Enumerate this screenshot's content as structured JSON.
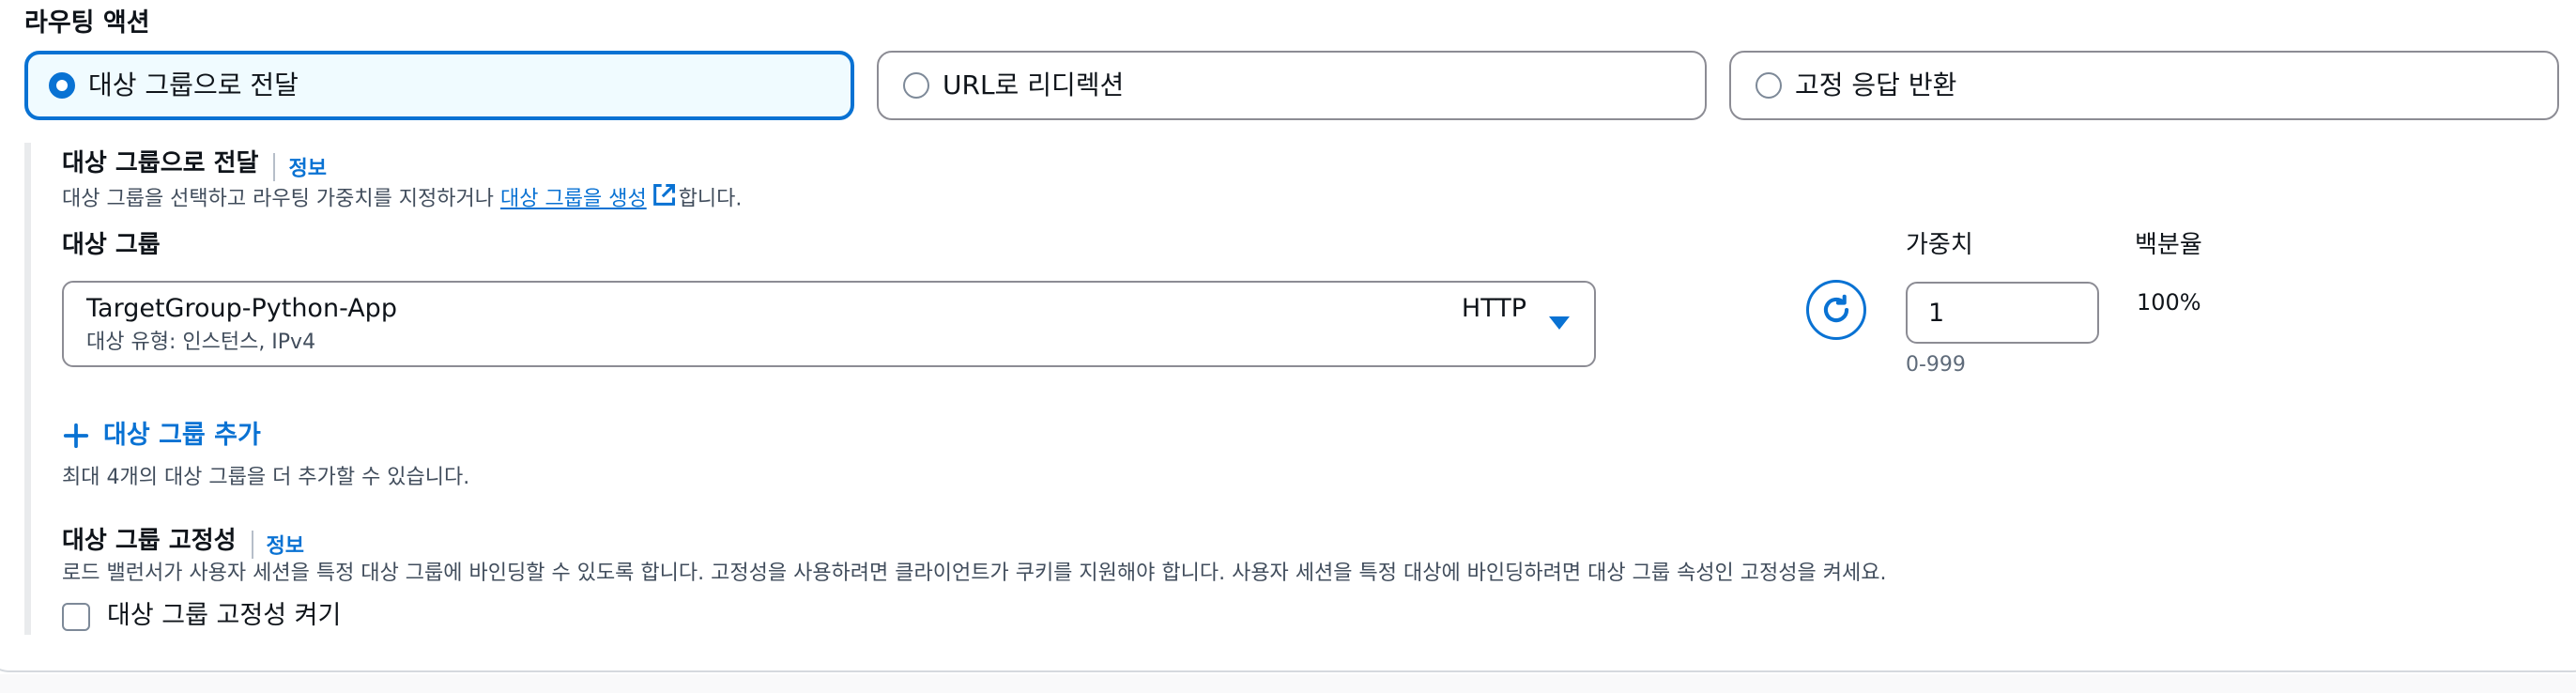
{
  "routing_action": {
    "title": "라우팅 액션",
    "options": [
      {
        "label": "대상 그룹으로 전달",
        "selected": true
      },
      {
        "label": "URL로 리디렉션",
        "selected": false
      },
      {
        "label": "고정 응답 반환",
        "selected": false
      }
    ]
  },
  "forward": {
    "title": "대상 그룹으로 전달",
    "info": "정보",
    "desc_prefix": "대상 그룹을 선택하고 라우팅 가중치를 지정하거나 ",
    "desc_link": "대상 그룹을 생성",
    "desc_suffix": "합니다.",
    "target_group_label": "대상 그룹",
    "selected_group": {
      "name": "TargetGroup-Python-App",
      "subtitle": "대상 유형: 인스턴스, IPv4",
      "protocol": "HTTP"
    },
    "weight_label": "가중치",
    "weight_value": "1",
    "weight_hint": "0-999",
    "percent_label": "백분율",
    "percent_value": "100%",
    "add_group_label": "대상 그룹 추가",
    "add_group_hint": "최대 4개의 대상 그룹을 더 추가할 수 있습니다."
  },
  "stickiness": {
    "title": "대상 그룹 고정성",
    "info": "정보",
    "desc": "로드 밸런서가 사용자 세션을 특정 대상 그룹에 바인딩할 수 있도록 합니다. 고정성을 사용하려면 클라이언트가 쿠키를 지원해야 합니다. 사용자 세션을 특정 대상에 바인딩하려면 대상 그룹 속성인 고정성을 켜세요.",
    "checkbox_label": "대상 그룹 고정성 켜기",
    "checked": false
  },
  "colors": {
    "accent": "#0972d3",
    "selected_bg": "#f0fbff",
    "border": "#8c8c94",
    "text_secondary": "#414d5c"
  },
  "icons": {
    "refresh": "refresh-icon",
    "external": "external-link-icon",
    "add": "plus-icon",
    "dropdown": "caret-down-icon"
  }
}
